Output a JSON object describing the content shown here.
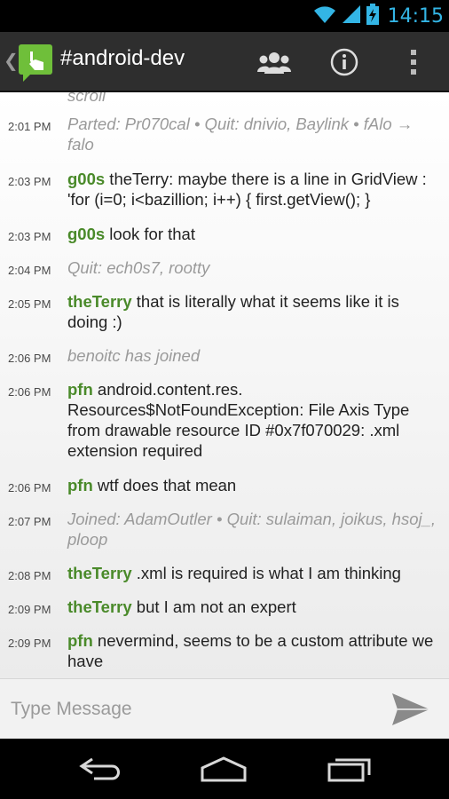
{
  "status_bar": {
    "time": "14:15",
    "icons": [
      "wifi-icon",
      "signal-icon",
      "battery-charging-icon"
    ]
  },
  "action_bar": {
    "title": "#android-dev",
    "actions": [
      "users-icon",
      "info-icon",
      "overflow-menu-icon"
    ]
  },
  "messages": [
    {
      "time": "",
      "type": "event",
      "nick": "",
      "text": "scroll"
    },
    {
      "time": "2:01 PM",
      "type": "event",
      "nick": "",
      "text": "Parted: Pr070cal • Quit: dnivio, Baylink • fAlo → falo"
    },
    {
      "time": "2:03 PM",
      "type": "message",
      "nick": "g00s",
      "text": " theTerry: maybe there is a line in GridView : 'for (i=0; i<bazillion; i++) { first.getView(); }"
    },
    {
      "time": "2:03 PM",
      "type": "message",
      "nick": "g00s",
      "text": " look for that"
    },
    {
      "time": "2:04 PM",
      "type": "event",
      "nick": "",
      "text": "Quit: ech0s7, rootty"
    },
    {
      "time": "2:05 PM",
      "type": "message",
      "nick": "theTerry",
      "text": " that is literally what it seems like it is doing :)"
    },
    {
      "time": "2:06 PM",
      "type": "event",
      "nick": "",
      "text": "benoitc has joined"
    },
    {
      "time": "2:06 PM",
      "type": "message",
      "nick": "pfn",
      "text": "  android.content.res. Resources$NotFoundException: File Axis Type from drawable resource ID #0x7f070029: .xml extension required"
    },
    {
      "time": "2:06 PM",
      "type": "message",
      "nick": "pfn",
      "text": " wtf does that mean"
    },
    {
      "time": "2:07 PM",
      "type": "event",
      "nick": "",
      "text": "Joined: AdamOutler • Quit: sulaiman, joikus, hsoj_, ploop"
    },
    {
      "time": "2:08 PM",
      "type": "message",
      "nick": "theTerry",
      "text": " .xml is required is what I am thinking"
    },
    {
      "time": "2:09 PM",
      "type": "message",
      "nick": "theTerry",
      "text": " but I am not an expert"
    },
    {
      "time": "2:09 PM",
      "type": "message",
      "nick": "pfn",
      "text": " nevermind, seems to be a custom attribute we have"
    }
  ],
  "input": {
    "placeholder": "Type Message",
    "send_icon": "send-icon"
  },
  "nav_bar": {
    "buttons": [
      "back-icon",
      "home-icon",
      "recent-apps-icon"
    ]
  },
  "colors": {
    "nick": "#4a8a2a",
    "clock": "#33b5e5",
    "action_bar": "#2e2e2e",
    "event_text": "#9a9a9a"
  }
}
